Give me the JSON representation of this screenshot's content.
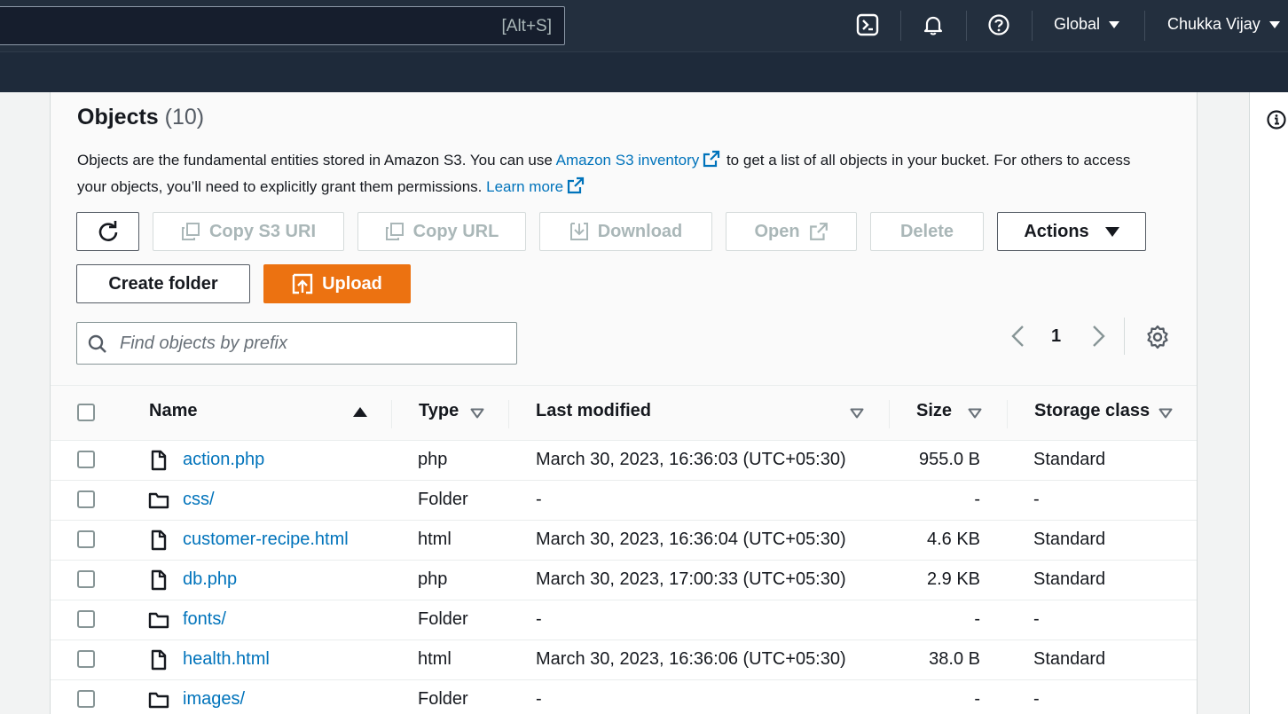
{
  "topbar": {
    "search_hint": "[Alt+S]",
    "region": "Global",
    "user": "Chukka Vijay"
  },
  "objects": {
    "title": "Objects",
    "count": "(10)",
    "desc_part1": "Objects are the fundamental entities stored in Amazon S3. You can use ",
    "inventory_link": "Amazon S3 inventory",
    "desc_part2": " to get a list of all objects in your bucket. For others to access your objects, you’ll need to explicitly grant them permissions. ",
    "learn_more": "Learn more"
  },
  "toolbar": {
    "copy_s3_uri": "Copy S3 URI",
    "copy_url": "Copy URL",
    "download": "Download",
    "open": "Open",
    "delete": "Delete",
    "actions": "Actions",
    "create_folder": "Create folder",
    "upload": "Upload"
  },
  "search": {
    "placeholder": "Find objects by prefix"
  },
  "pagination": {
    "page": "1"
  },
  "table": {
    "headers": {
      "name": "Name",
      "type": "Type",
      "last_modified": "Last modified",
      "size": "Size",
      "storage_class": "Storage class"
    },
    "rows": [
      {
        "name": "action.php",
        "kind": "file",
        "type": "php",
        "modified": "March 30, 2023, 16:36:03 (UTC+05:30)",
        "size": "955.0 B",
        "storage": "Standard"
      },
      {
        "name": "css/",
        "kind": "folder",
        "type": "Folder",
        "modified": "-",
        "size": "-",
        "storage": "-"
      },
      {
        "name": "customer-recipe.html",
        "kind": "file",
        "type": "html",
        "modified": "March 30, 2023, 16:36:04 (UTC+05:30)",
        "size": "4.6 KB",
        "storage": "Standard"
      },
      {
        "name": "db.php",
        "kind": "file",
        "type": "php",
        "modified": "March 30, 2023, 17:00:33 (UTC+05:30)",
        "size": "2.9 KB",
        "storage": "Standard"
      },
      {
        "name": "fonts/",
        "kind": "folder",
        "type": "Folder",
        "modified": "-",
        "size": "-",
        "storage": "-"
      },
      {
        "name": "health.html",
        "kind": "file",
        "type": "html",
        "modified": "March 30, 2023, 16:36:06 (UTC+05:30)",
        "size": "38.0 B",
        "storage": "Standard"
      },
      {
        "name": "images/",
        "kind": "folder",
        "type": "Folder",
        "modified": "-",
        "size": "-",
        "storage": "-"
      }
    ]
  },
  "colors": {
    "nav_bg": "#232f3e",
    "link": "#0073bb",
    "primary": "#ec7211"
  }
}
